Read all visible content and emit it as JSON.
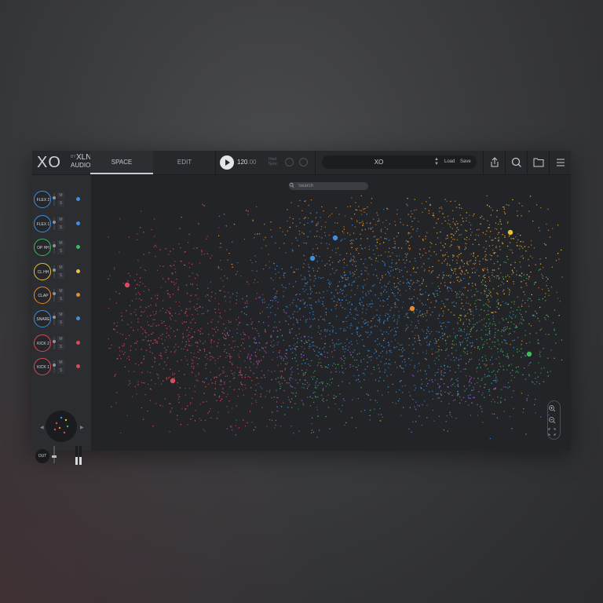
{
  "header": {
    "logo_xo": "XO",
    "logo_by": "BY",
    "logo_xln": "XLN",
    "logo_audio": "AUDIO",
    "tabs": [
      {
        "label": "SPACE",
        "active": true
      },
      {
        "label": "EDIT",
        "active": false
      }
    ],
    "tempo_int": "120",
    "tempo_dec": ".00",
    "host_sync_line1": "Host",
    "host_sync_line2": "Sync",
    "kit_name": "XO",
    "load_label": "Load",
    "save_label": "Save",
    "icons": [
      "share-icon",
      "search-icon",
      "folder-icon",
      "menu-icon"
    ]
  },
  "search": {
    "placeholder": "Search"
  },
  "pads": [
    {
      "label": "FLEX 2",
      "color": "#3d8fe0",
      "m": "M",
      "s": "S"
    },
    {
      "label": "FLEX 1",
      "color": "#3d8fe0",
      "m": "M",
      "s": "S"
    },
    {
      "label": "OP HH",
      "color": "#3dbb5a",
      "m": "M",
      "s": "S"
    },
    {
      "label": "CL HH",
      "color": "#e9c23a",
      "m": "M",
      "s": "S"
    },
    {
      "label": "CLAP",
      "color": "#e88a2e",
      "m": "M",
      "s": "S"
    },
    {
      "label": "SNARE",
      "color": "#3d8fe0",
      "m": "M",
      "s": "S"
    },
    {
      "label": "KICK 2",
      "color": "#d94a5a",
      "m": "M",
      "s": "S"
    },
    {
      "label": "KICK 1",
      "color": "#d94a5a",
      "m": "M",
      "s": "S"
    }
  ],
  "out_label": "OUT",
  "colors": {
    "red": "#d94a5a",
    "blue": "#3d8fe0",
    "orange": "#e88a2e",
    "yellow": "#e9c23a",
    "green": "#3dbb5a",
    "purple": "#a45ad6"
  }
}
